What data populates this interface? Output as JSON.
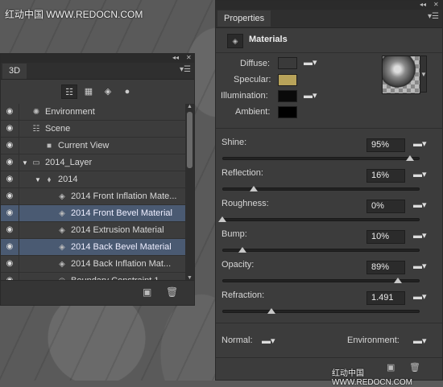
{
  "watermark_top": "红动中国 WWW.REDOCN.COM",
  "watermark_bottom": "红动中国 WWW.REDOCN.COM",
  "panel3d": {
    "collapse": "◂◂",
    "close": "✕",
    "tab_label": "3D",
    "menu_icon": "menu-icon",
    "filter_icons": [
      "scene-filter-icon",
      "mesh-filter-icon",
      "material-filter-icon",
      "light-filter-icon"
    ],
    "layers": [
      {
        "label": "Environment",
        "icon": "environment-icon",
        "indent": 0,
        "expand": "",
        "eye": true,
        "selected": false
      },
      {
        "label": "Scene",
        "icon": "scene-icon",
        "indent": 0,
        "expand": "",
        "eye": true,
        "selected": false
      },
      {
        "label": "Current View",
        "icon": "camera-icon",
        "indent": 1,
        "expand": "",
        "eye": true,
        "selected": false
      },
      {
        "label": "2014_Layer",
        "icon": "folder-icon",
        "indent": 0,
        "expand": "▼",
        "eye": true,
        "selected": false
      },
      {
        "label": "2014",
        "icon": "mesh-icon",
        "indent": 1,
        "expand": "▼",
        "eye": true,
        "selected": false
      },
      {
        "label": "2014 Front Inflation Mate...",
        "icon": "material-icon",
        "indent": 2,
        "expand": "",
        "eye": true,
        "selected": false
      },
      {
        "label": "2014 Front Bevel Material",
        "icon": "material-icon",
        "indent": 2,
        "expand": "",
        "eye": true,
        "selected": true
      },
      {
        "label": "2014 Extrusion Material",
        "icon": "material-icon",
        "indent": 2,
        "expand": "",
        "eye": true,
        "selected": false
      },
      {
        "label": "2014 Back Bevel Material",
        "icon": "material-icon",
        "indent": 2,
        "expand": "",
        "eye": true,
        "selected": true
      },
      {
        "label": "2014 Back Inflation Mat...",
        "icon": "material-icon",
        "indent": 2,
        "expand": "",
        "eye": true,
        "selected": false
      },
      {
        "label": "Boundary Constraint 1",
        "icon": "constraint-icon",
        "indent": 2,
        "expand": "",
        "eye": true,
        "selected": false
      }
    ]
  },
  "properties": {
    "collapse": "◂◂",
    "close": "✕",
    "tab_label": "Properties",
    "header_title": "Materials",
    "colors": {
      "diffuse": "#3a3a3a",
      "specular": "#b8a35a",
      "illumination": "#0a0a0a",
      "ambient": "#000000"
    },
    "color_labels": {
      "diffuse": "Diffuse:",
      "specular": "Specular:",
      "illumination": "Illumination:",
      "ambient": "Ambient:"
    },
    "sliders": [
      {
        "label": "Shine:",
        "value": "95%",
        "level": 95
      },
      {
        "label": "Reflection:",
        "value": "16%",
        "level": 16
      },
      {
        "label": "Roughness:",
        "value": "0%",
        "level": 0
      },
      {
        "label": "Bump:",
        "value": "10%",
        "level": 10
      },
      {
        "label": "Opacity:",
        "value": "89%",
        "level": 89
      },
      {
        "label": "Refraction:",
        "value": "1.491",
        "level": 25
      }
    ],
    "normal_label": "Normal:",
    "environment_label": "Environment:"
  }
}
